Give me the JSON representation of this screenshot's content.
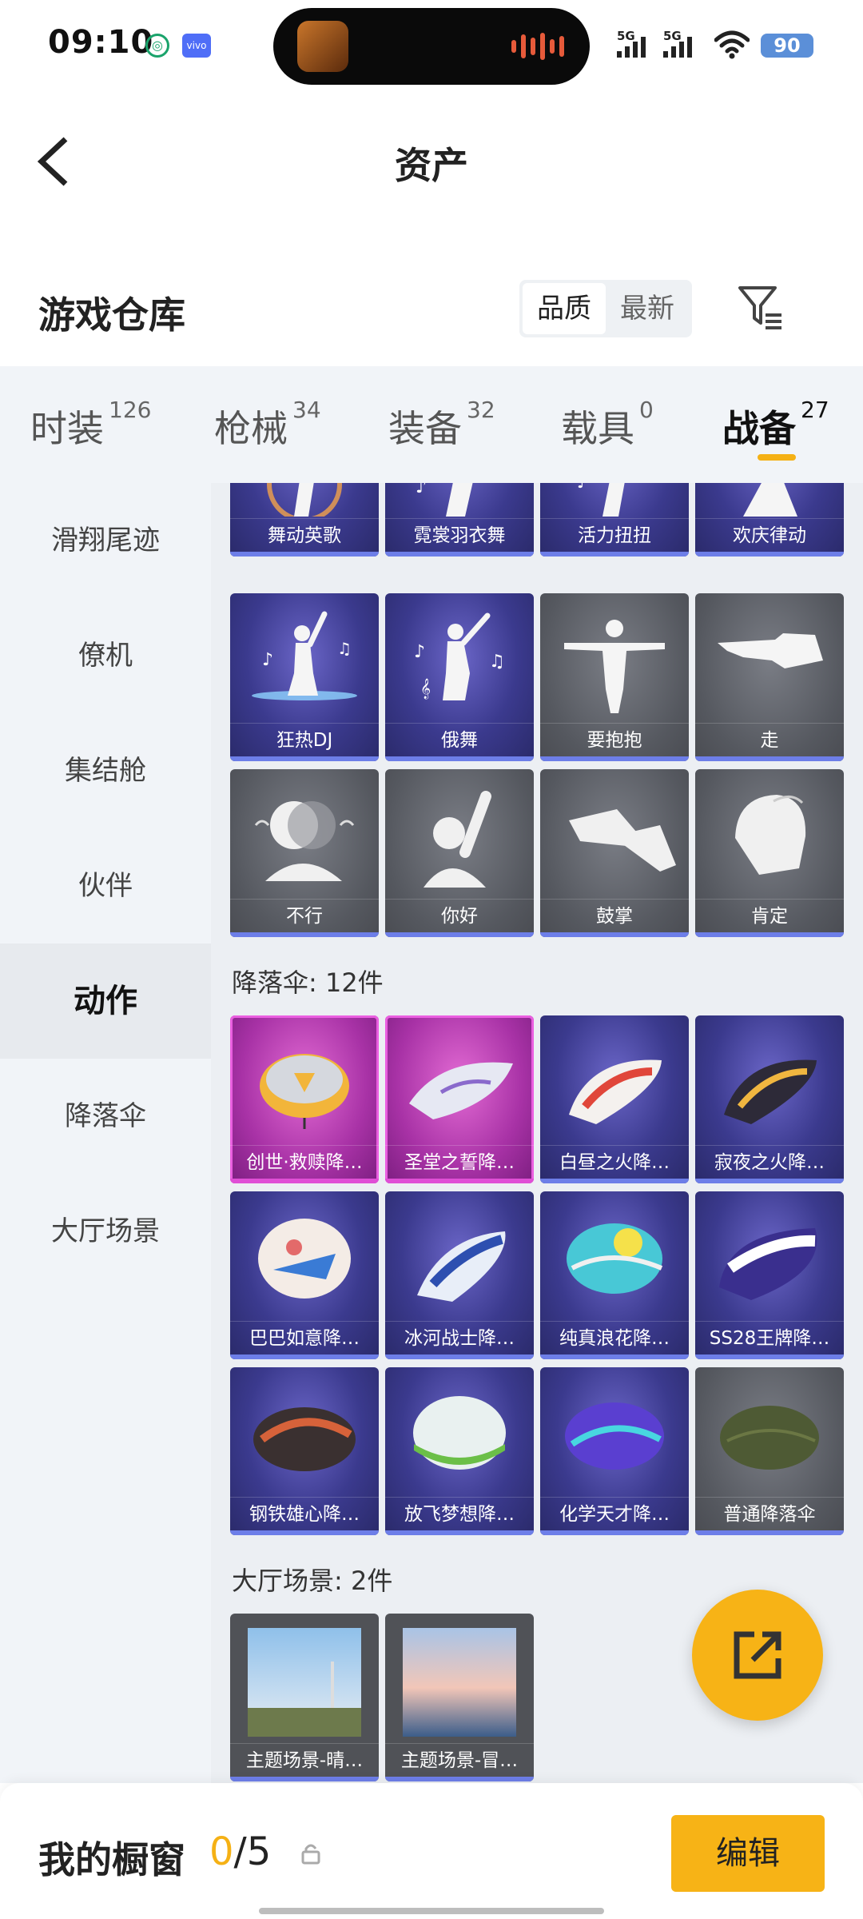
{
  "status_bar": {
    "time": "09:10",
    "network1": "5G",
    "network2": "5G",
    "battery": "90"
  },
  "header": {
    "title": "资产"
  },
  "warehouse": {
    "title": "游戏仓库",
    "sort_options": [
      "品质",
      "最新"
    ],
    "active_sort": "品质"
  },
  "tabs": [
    {
      "label": "时装",
      "count": "126"
    },
    {
      "label": "枪械",
      "count": "34"
    },
    {
      "label": "装备",
      "count": "32"
    },
    {
      "label": "载具",
      "count": "0"
    },
    {
      "label": "战备",
      "count": "27"
    }
  ],
  "sidebar": [
    {
      "label": "滑翔尾迹"
    },
    {
      "label": "僚机"
    },
    {
      "label": "集结舱"
    },
    {
      "label": "伙伴"
    },
    {
      "label": "动作"
    },
    {
      "label": "降落伞"
    },
    {
      "label": "大厅场景"
    }
  ],
  "actions": {
    "row1": [
      "舞动英歌",
      "霓裳羽衣舞",
      "活力扭扭",
      "欢庆律动"
    ],
    "row2": [
      "狂热DJ",
      "俄舞",
      "要抱抱",
      "走"
    ],
    "row3": [
      "不行",
      "你好",
      "鼓掌",
      "肯定"
    ]
  },
  "parachutes": {
    "title": "降落伞: 12件",
    "items": [
      "创世·救赎降…",
      "圣堂之誓降…",
      "白昼之火降…",
      "寂夜之火降…",
      "巴巴如意降…",
      "冰河战士降…",
      "纯真浪花降…",
      "SS28王牌降…",
      "钢铁雄心降…",
      "放飞梦想降…",
      "化学天才降…",
      "普通降落伞"
    ]
  },
  "scenes": {
    "title": "大厅场景: 2件",
    "items": [
      "主题场景-晴…",
      "主题场景-冒…"
    ]
  },
  "showcase": {
    "label": "我的橱窗",
    "current": "0",
    "total": "/5",
    "edit_label": "编辑"
  },
  "colors": {
    "accent": "#f7b316",
    "card_purple": "#3b3a8e",
    "card_gray": "#55585f",
    "card_pink": "#a832a6"
  }
}
